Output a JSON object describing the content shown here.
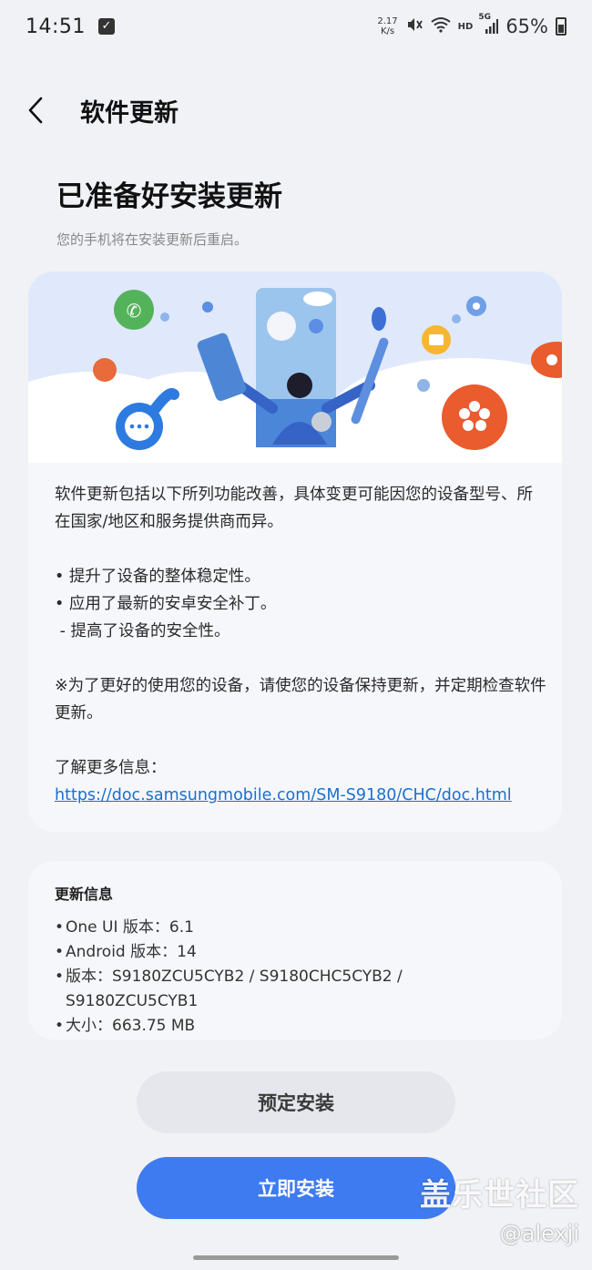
{
  "status_bar": {
    "time": "14:51",
    "net_speed_value": "2.17",
    "net_speed_unit": "K/s",
    "hd_label": "HD",
    "network_label": "5G",
    "battery": "65%"
  },
  "header": {
    "title": "软件更新"
  },
  "main": {
    "heading": "已准备好安装更新",
    "subtitle": "您的手机将在安装更新后重启。"
  },
  "description": {
    "intro": "软件更新包括以下所列功能改善，具体变更可能因您的设备型号、所在国家/地区和服务提供商而异。",
    "bullet_1": "• 提升了设备的整体稳定性。",
    "bullet_2": "• 应用了最新的安卓安全补丁。",
    "sub_bullet": " - 提高了设备的安全性。",
    "notice": "※为了更好的使用您的设备，请使您的设备保持更新，并定期检查软件更新。",
    "more_info_label": "了解更多信息：",
    "more_info_link": "https://doc.samsungmobile.com/SM-S9180/CHC/doc.html"
  },
  "update_info": {
    "title": "更新信息",
    "one_ui": "One UI 版本：6.1",
    "android": "Android 版本：14",
    "version_line_1": "版本：S9180ZCU5CYB2 / S9180CHC5CYB2 /",
    "version_line_2": "S9180ZCU5CYB1",
    "size": "大小：663.75 MB"
  },
  "buttons": {
    "schedule": "预定安装",
    "install_now": "立即安装"
  },
  "watermark": {
    "site": "盖乐世社区",
    "user": "@alexji"
  },
  "colors": {
    "primary_button": "#3e7bf0",
    "secondary_button": "#e6e7ec",
    "link": "#1a6fcf",
    "background": "#f1f2f6",
    "card": "#f6f7fb"
  }
}
